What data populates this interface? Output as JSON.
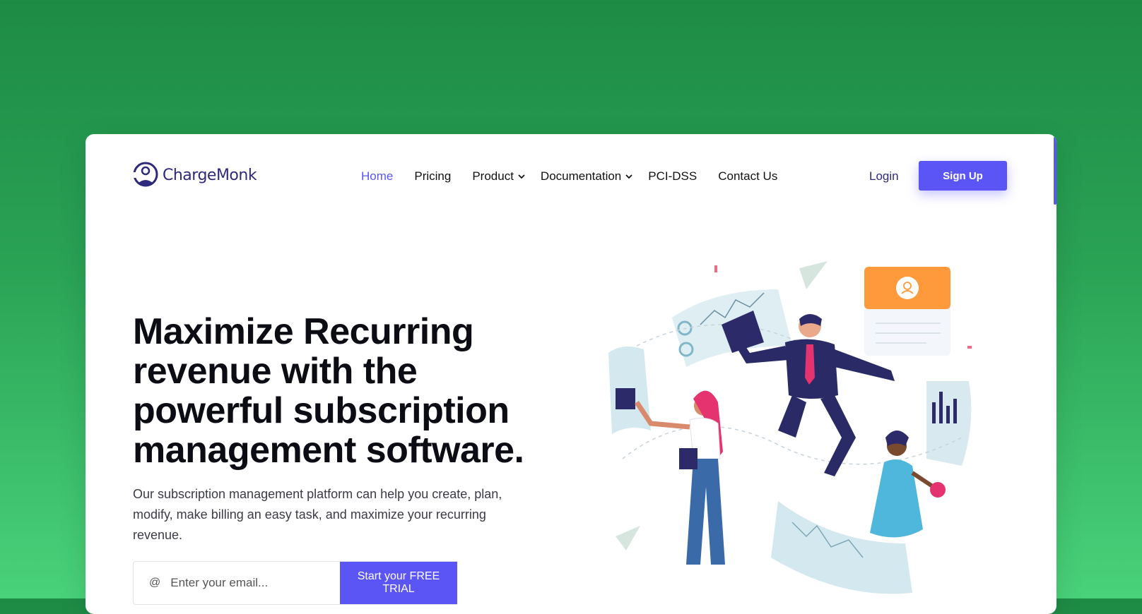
{
  "brand": {
    "name": "ChargeMonk"
  },
  "nav": {
    "items": [
      {
        "label": "Home",
        "active": true,
        "dropdown": false
      },
      {
        "label": "Pricing",
        "active": false,
        "dropdown": false
      },
      {
        "label": "Product",
        "active": false,
        "dropdown": true
      },
      {
        "label": "Documentation",
        "active": false,
        "dropdown": true
      },
      {
        "label": "PCI-DSS",
        "active": false,
        "dropdown": false
      },
      {
        "label": "Contact Us",
        "active": false,
        "dropdown": false
      }
    ],
    "login_label": "Login",
    "signup_label": "Sign Up"
  },
  "hero": {
    "headline_line1": "Maximize Recurring",
    "headline_line2": "revenue with the",
    "headline_line3_pre": "powerful ",
    "headline_highlight": "subscription",
    "headline_line4": "management software.",
    "subtitle": "Our subscription management platform can help you create, plan, modify, make billing an easy task, and maximize your recurring revenue.",
    "email_placeholder": "Enter your email...",
    "cta_label": "Start your FREE TRIAL"
  },
  "colors": {
    "accent": "#5b55f5",
    "highlight": "#ffd37a",
    "brand_text": "#2d2a7a",
    "background_top": "#1e8b45",
    "background_bottom": "#49d27a"
  },
  "icons": {
    "logo": "monk-logo-icon",
    "email": "at-icon",
    "dropdown": "chevron-down-icon"
  }
}
